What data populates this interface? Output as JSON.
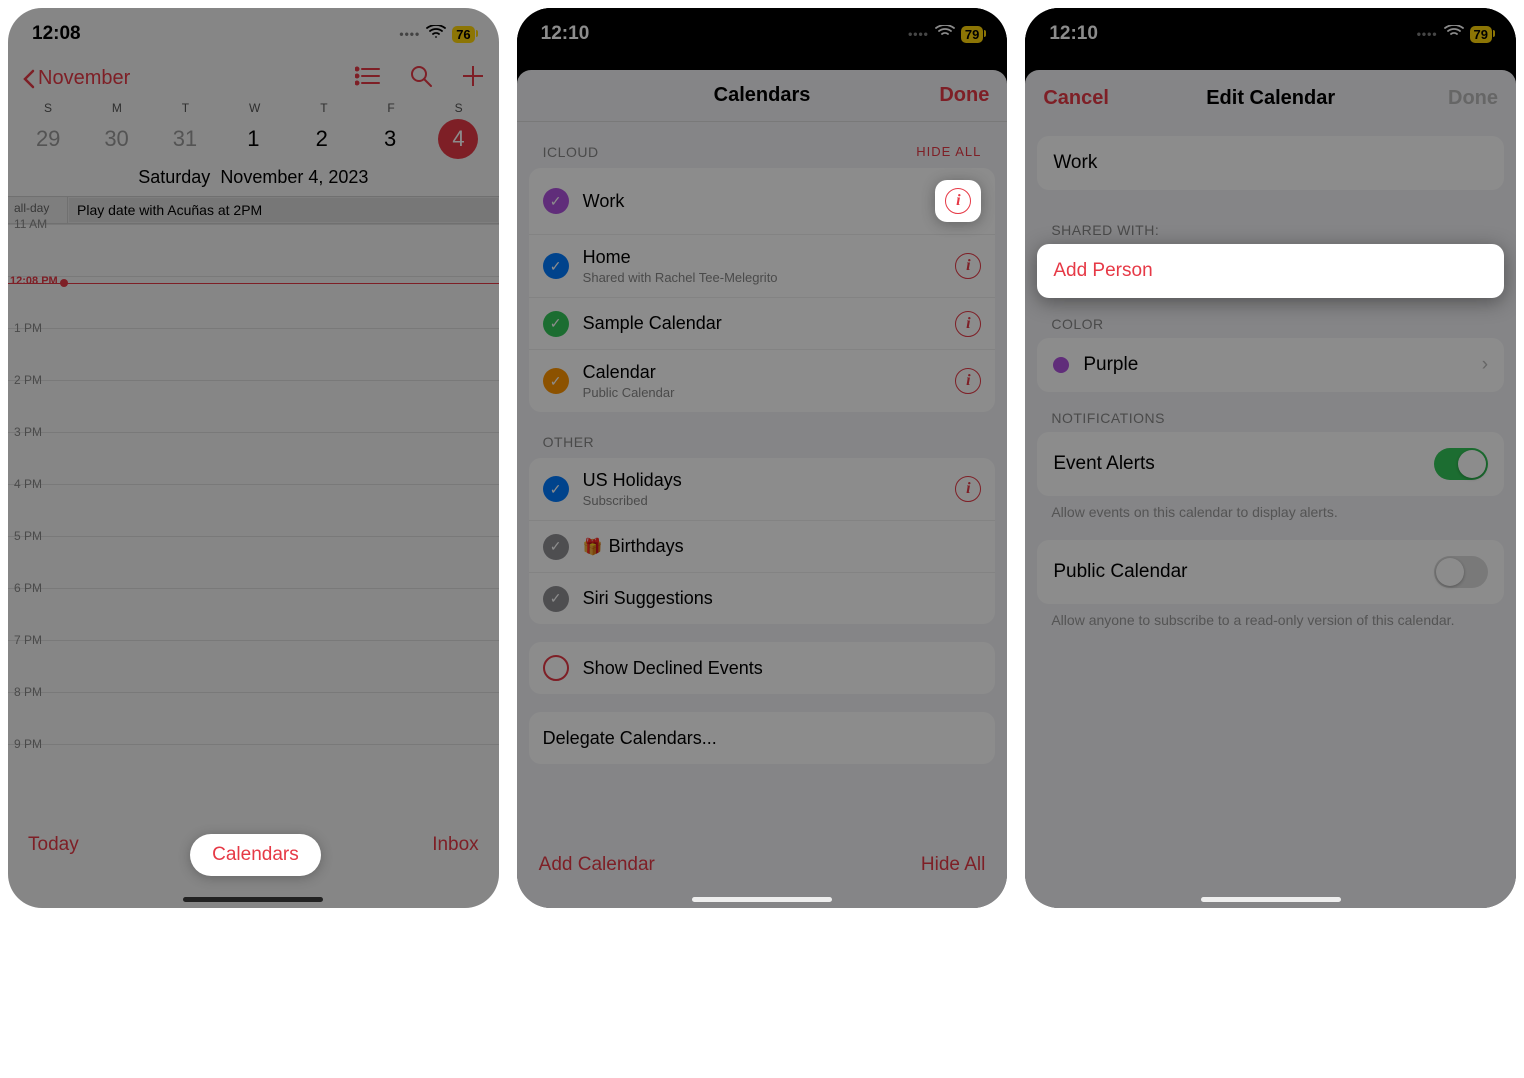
{
  "screen1": {
    "status": {
      "time": "12:08",
      "battery": "76"
    },
    "nav_back": "November",
    "weekdays": [
      "S",
      "M",
      "T",
      "W",
      "T",
      "F",
      "S"
    ],
    "dates": [
      "29",
      "30",
      "31",
      "1",
      "2",
      "3",
      "4"
    ],
    "date_long_prefix": "Saturday",
    "date_long": "November 4, 2023",
    "allday_label": "all-day",
    "allday_event": "Play date with Acuñas at 2PM",
    "now_label": "12:08 PM",
    "hours": [
      "11 AM",
      "",
      "1 PM",
      "2 PM",
      "3 PM",
      "4 PM",
      "5 PM",
      "6 PM",
      "7 PM",
      "8 PM",
      "9 PM"
    ],
    "toolbar": {
      "today": "Today",
      "calendars": "Calendars",
      "inbox": "Inbox"
    }
  },
  "screen2": {
    "status": {
      "time": "12:10",
      "battery": "79"
    },
    "title": "Calendars",
    "done": "Done",
    "section_icloud": "ICLOUD",
    "hide_all": "HIDE ALL",
    "icloud": [
      {
        "name": "Work",
        "color": "purple",
        "info_highlight": true
      },
      {
        "name": "Home",
        "sub": "Shared with Rachel Tee-Melegrito",
        "color": "blue"
      },
      {
        "name": "Sample Calendar",
        "color": "green"
      },
      {
        "name": "Calendar",
        "sub": "Public Calendar",
        "color": "orange"
      }
    ],
    "section_other": "OTHER",
    "other": [
      {
        "name": "US Holidays",
        "sub": "Subscribed",
        "color": "blue",
        "info": true
      },
      {
        "name": "Birthdays",
        "color": "gray",
        "gift": true
      },
      {
        "name": "Siri Suggestions",
        "color": "gray"
      }
    ],
    "show_declined": "Show Declined Events",
    "delegate": "Delegate Calendars...",
    "toolbar": {
      "add": "Add Calendar",
      "hide": "Hide All"
    }
  },
  "screen3": {
    "status": {
      "time": "12:10",
      "battery": "79"
    },
    "cancel": "Cancel",
    "title": "Edit Calendar",
    "done": "Done",
    "name_value": "Work",
    "shared_with": "SHARED WITH:",
    "add_person": "Add Person",
    "color_label": "COLOR",
    "color_value": "Purple",
    "notifications_label": "NOTIFICATIONS",
    "event_alerts": "Event Alerts",
    "event_alerts_hint": "Allow events on this calendar to display alerts.",
    "public_calendar": "Public Calendar",
    "public_hint": "Allow anyone to subscribe to a read-only version of this calendar."
  }
}
